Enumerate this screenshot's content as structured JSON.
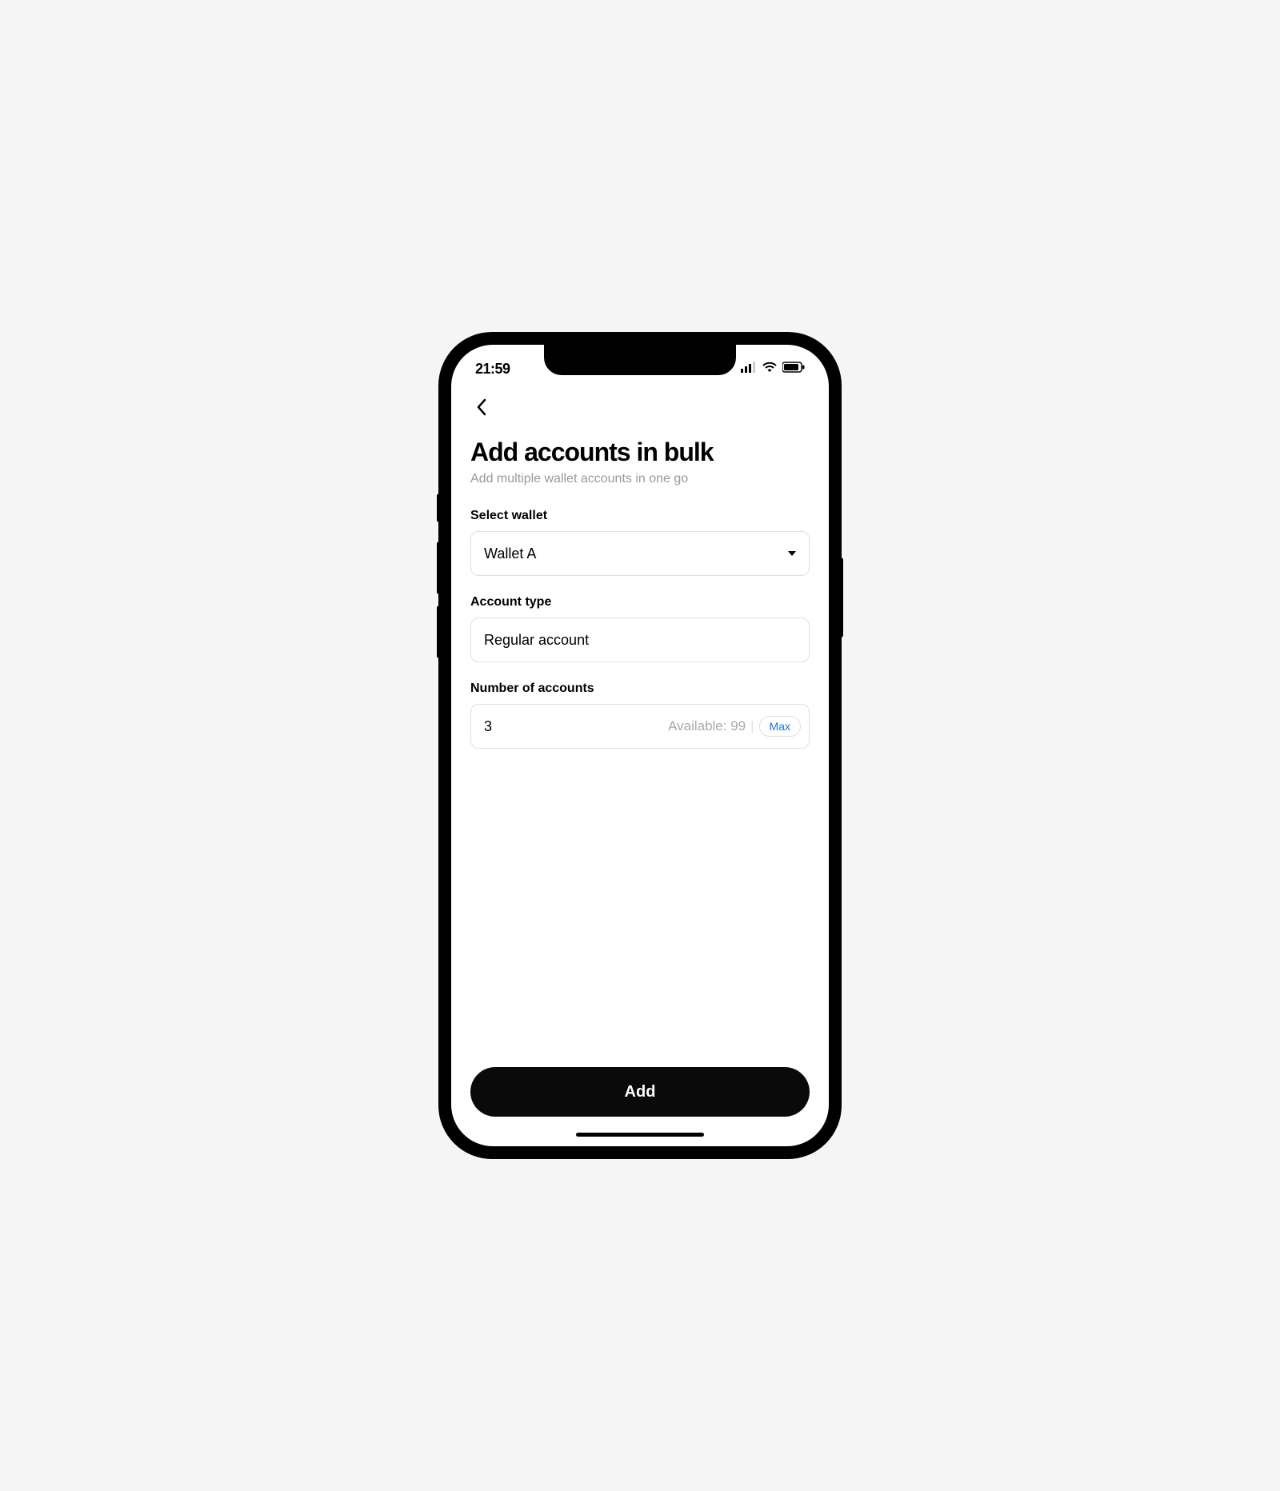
{
  "status": {
    "time": "21:59"
  },
  "header": {
    "title": "Add accounts in bulk",
    "subtitle": "Add multiple wallet accounts in one go"
  },
  "form": {
    "wallet": {
      "label": "Select wallet",
      "value": "Wallet A"
    },
    "account_type": {
      "label": "Account type",
      "value": "Regular account"
    },
    "number": {
      "label": "Number of accounts",
      "value": "3",
      "available_label": "Available: 99",
      "max_label": "Max"
    }
  },
  "actions": {
    "add_label": "Add"
  }
}
